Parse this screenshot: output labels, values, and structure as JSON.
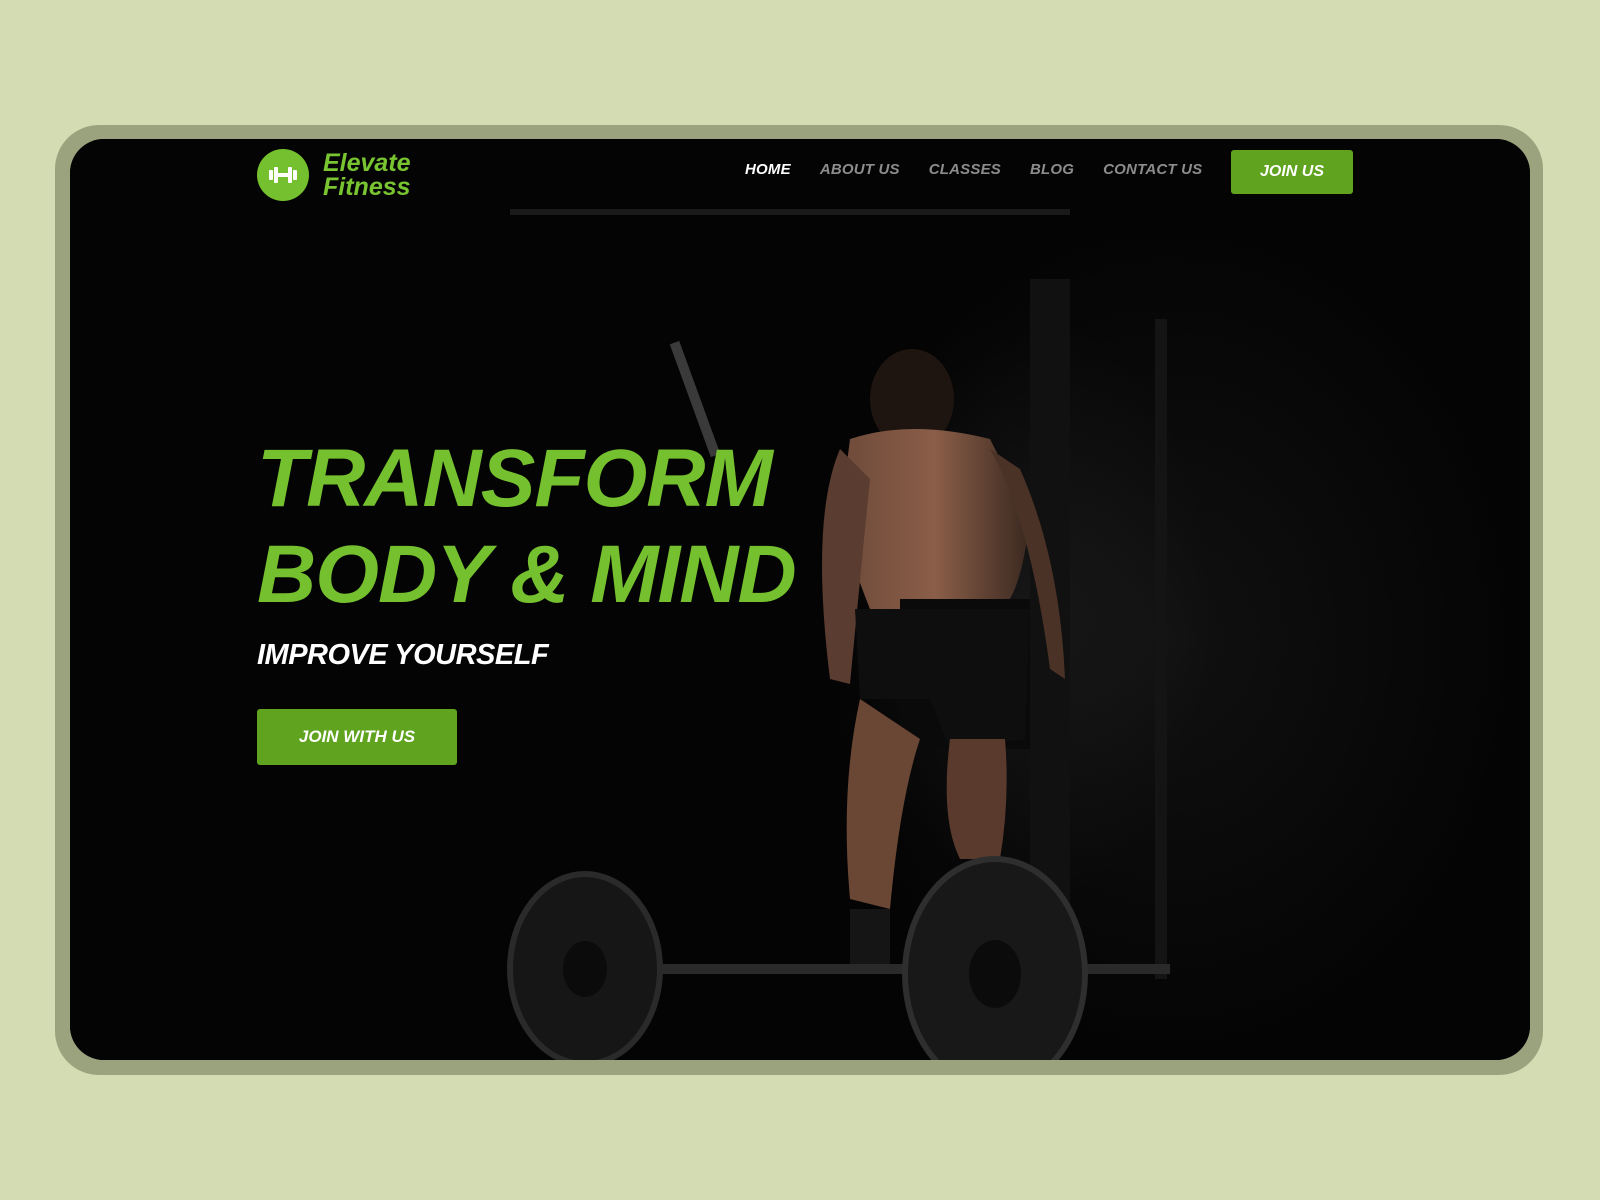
{
  "brand": {
    "name_line1": "Elevate",
    "name_line2": "Fitness",
    "logo_icon": "dumbbell-icon",
    "accent_color": "#74c02e"
  },
  "nav": {
    "items": [
      {
        "label": "HOME",
        "active": true
      },
      {
        "label": "ABOUT US",
        "active": false
      },
      {
        "label": "CLASSES",
        "active": false
      },
      {
        "label": "BLOG",
        "active": false
      },
      {
        "label": "CONTACT US",
        "active": false
      }
    ],
    "cta_label": "JOIN US"
  },
  "hero": {
    "headline_line1": "TRANSFORM",
    "headline_line2": "BODY & MIND",
    "subheadline": "IMPROVE YOURSELF",
    "cta_label": "JOIN WITH US",
    "background_image": "athlete-with-barbell-photo"
  }
}
